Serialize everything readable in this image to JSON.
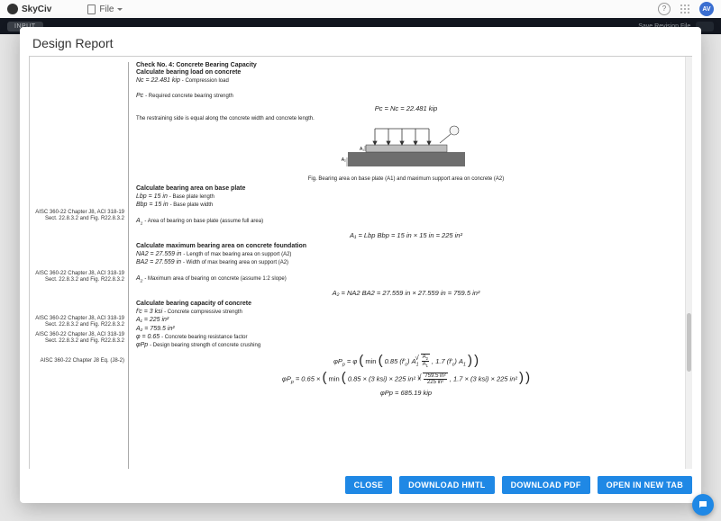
{
  "app": {
    "brand": "SkyCiv",
    "file_label": "File",
    "avatar_initials": "AV",
    "input_pill": "INPUT",
    "revision_hint": "Save Revision File",
    "help_glyph": "?"
  },
  "modal": {
    "title": "Design Report",
    "buttons": {
      "close": "CLOSE",
      "download_html": "DOWNLOAD HMTL",
      "download_pdf": "DOWNLOAD PDF",
      "open_new_tab": "OPEN IN NEW TAB"
    }
  },
  "refs": {
    "r1": "AISC 360-22 Chapter J8, ACI 318-19 Sect. 22.8.3.2 and Fig. R22.8.3.2",
    "r2": "AISC 360-22 Chapter J8, ACI 318-19 Sect. 22.8.3.2 and Fig. R22.8.3.2",
    "r3": "AISC 360-22 Chapter J8, ACI 318-19 Sect. 22.8.3.2 and Fig. R22.8.3.2",
    "r4": "AISC 360-22 Chapter J8, ACI 318-19 Sect. 22.8.3.2 and Fig. R22.8.3.2",
    "r5": "AISC 360-22 Chapter J8 Eq. (J8-2)"
  },
  "report": {
    "check_title": "Check No. 4: Concrete Bearing Capacity",
    "bearing_load_title": "Calculate bearing load on concrete",
    "Nc_line": "Nc = 22.481 kip",
    "Nc_desc": "- Compression load",
    "Pc_line": "Pc",
    "Pc_desc": "- Required concrete bearing strength",
    "Pc_eq": "Pc = Nc = 22.481 kip",
    "restrain_note": "The restraining side is equal along the concrete width and concrete length.",
    "fig_lbl_A1": "A₁",
    "fig_lbl_A2": "A₂",
    "fig_caption": "Fig. Bearing area on base plate (A1) and maximum support area on concrete (A2)",
    "areaA_title": "Calculate bearing area on base plate",
    "Lbp_line": "Lbp = 15 in",
    "Lbp_desc": "- Base plate length",
    "Bbp_line": "Bbp = 15 in",
    "Bbp_desc": "- Base plate width",
    "A1_desc": "- Area of bearing on base plate (assume full area)",
    "A1_eq": "A₁ = Lbp Bbp = 15 in × 15 in = 225 in²",
    "areaB_title": "Calculate maximum bearing area on concrete foundation",
    "NA2_line": "NA2 = 27.559 in",
    "NA2_desc": "- Length of max bearing area on support (A2)",
    "BA2_line": "BA2 = 27.559 in",
    "BA2_desc": "- Width of max bearing area on support (A2)",
    "A2_desc": "- Maximum area of bearing on concrete (assume 1:2 slope)",
    "A2_eq": "A₂ = NA2 BA2 = 27.559 in × 27.559 in = 759.5 in²",
    "cap_title": "Calculate bearing capacity of concrete",
    "fc_line": "f'c = 3 ksi",
    "fc_desc": "- Concrete compressive strength",
    "A1v": "A₁ = 225 in²",
    "A2v": "A₂ = 759.5 in²",
    "phi_line": "φ = 0.65",
    "phi_desc": "- Concrete bearing resistance factor",
    "phiPp_sym": "φPp",
    "phiPp_desc": "- Design bearing strength of concrete crushing",
    "eq_sym": "φPp = φ ( min ( 0.85 (f'c) A₁ √(A₂/A₁) , 1.7 (f'c) A₁ ) )",
    "eq_num_prefix": "φPp = 0.65 × ( min ( 0.85 × (3 ksi) × 225 in² ×",
    "eq_num_frac_num": "759.5 in²",
    "eq_num_frac_den": "225 in²",
    "eq_num_suffix": ", 1.7 × (3 ksi) × 225 in² ) )",
    "eq_res": "φPp = 685.19 kip"
  }
}
